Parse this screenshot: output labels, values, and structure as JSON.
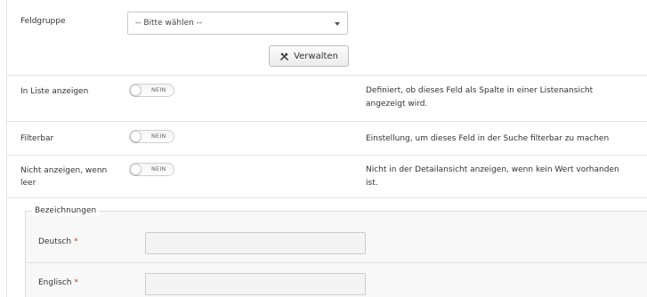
{
  "feldgruppe": {
    "label": "Feldgruppe",
    "select_value": "-- Bitte wählen --",
    "manage_label": "Verwalten"
  },
  "toggles": [
    {
      "label": "In Liste anzeigen",
      "state": "NEIN",
      "description": "Definiert, ob dieses Feld als Spalte in einer Listenansicht angezeigt wird."
    },
    {
      "label": "Filterbar",
      "state": "NEIN",
      "description": "Einstellung, um dieses Feld in der Suche filterbar zu machen"
    },
    {
      "label": "Nicht anzeigen, wenn leer",
      "state": "NEIN",
      "description": "Nicht in der Detailansicht anzeigen, wenn kein Wert vorhanden ist."
    }
  ],
  "bezeichnungen": {
    "legend": "Bezeichnungen",
    "fields": [
      {
        "label": "Deutsch",
        "required_mark": "*",
        "value": ""
      },
      {
        "label": "Englisch",
        "required_mark": "*",
        "value": ""
      }
    ]
  },
  "colors": {
    "required": "#c0392b",
    "border": "#e3e3e3",
    "fieldset_bg": "#f8f8f8"
  }
}
